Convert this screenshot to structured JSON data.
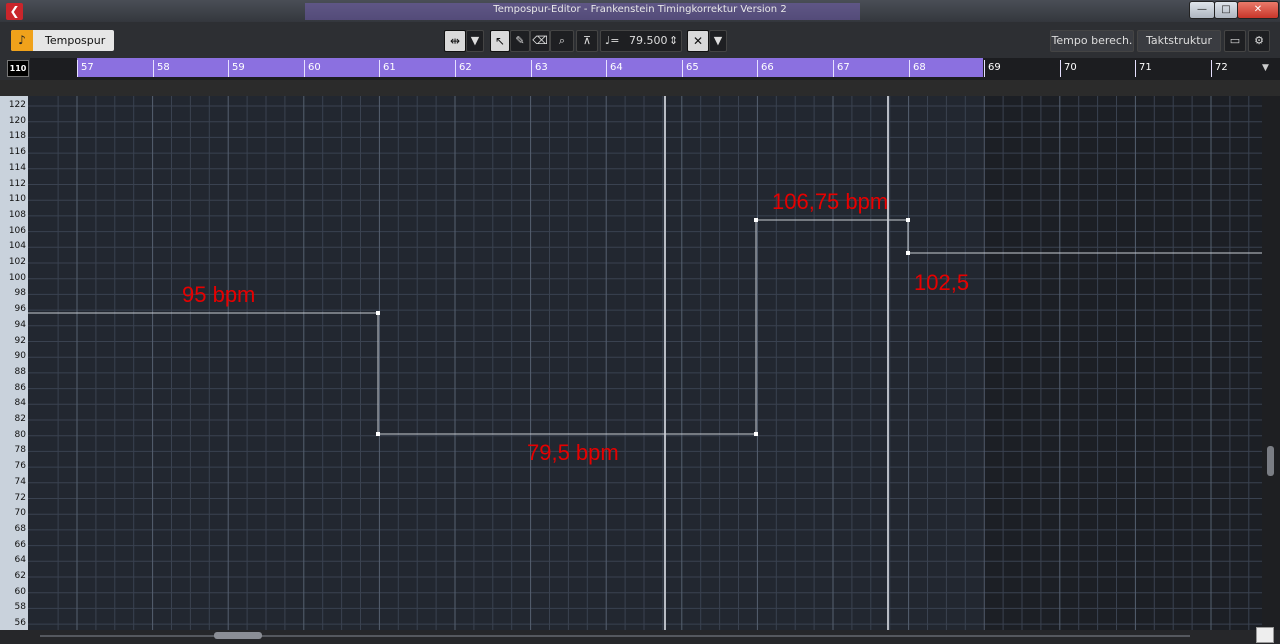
{
  "window": {
    "title": "Tempospur-Editor - Frankenstein Timingkorrektur Version 2",
    "controls": [
      "—",
      "□",
      "✕"
    ]
  },
  "toolbar": {
    "track_label": "Tempospur",
    "tempo_value": "79.500",
    "tempo_calc_label": "Tempo berech.",
    "signature_label": "Taktstruktur ve."
  },
  "ruler": {
    "zoom": "110",
    "bars": [
      "57",
      "58",
      "59",
      "60",
      "61",
      "62",
      "63",
      "64",
      "65",
      "66",
      "67",
      "68",
      "69",
      "70",
      "71",
      "72"
    ]
  },
  "tempo_axis": {
    "labels": [
      "122",
      "120",
      "118",
      "116",
      "114",
      "112",
      "110",
      "108",
      "106",
      "104",
      "102",
      "100",
      "98",
      "96",
      "94",
      "92",
      "90",
      "88",
      "86",
      "84",
      "82",
      "80",
      "78",
      "76",
      "74",
      "72",
      "70",
      "68",
      "66",
      "64",
      "62",
      "60",
      "58",
      "56"
    ]
  },
  "annotations": {
    "a1": "95 bpm",
    "a2": "79,5 bpm",
    "a3": "106,75 bpm",
    "a4": "102,5"
  }
}
